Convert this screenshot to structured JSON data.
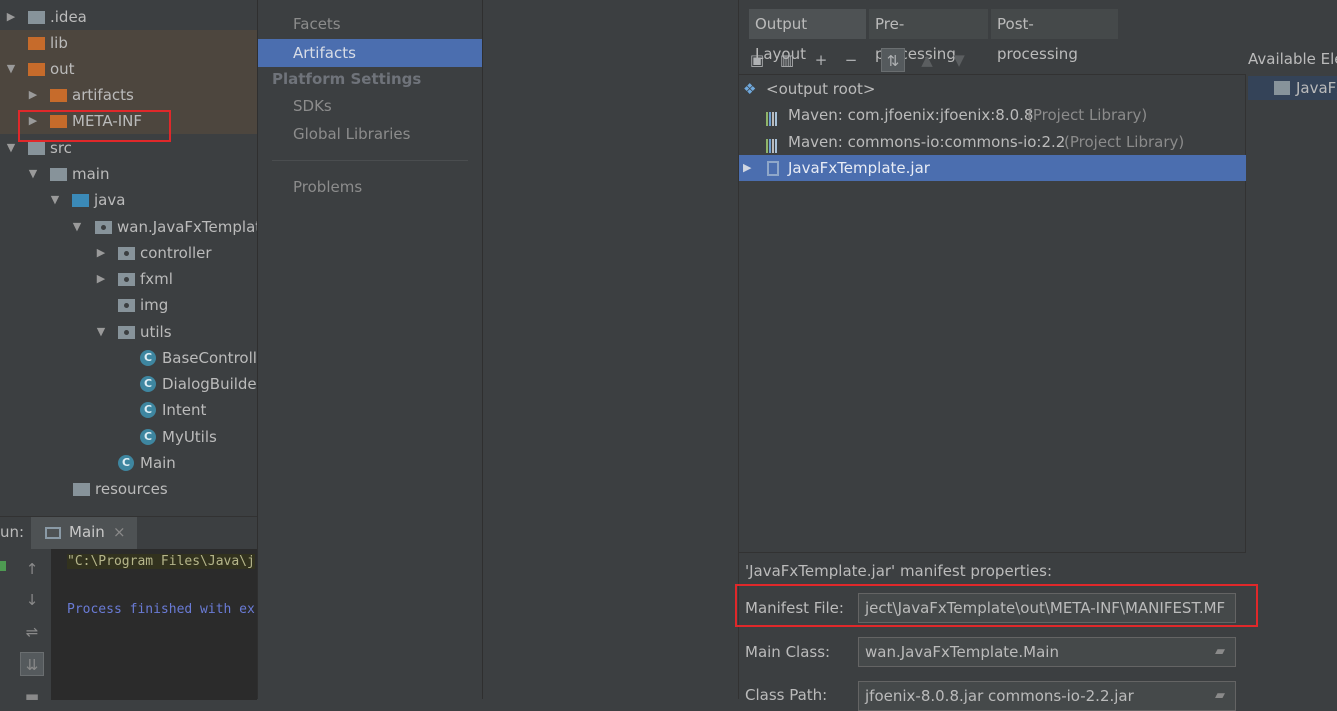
{
  "project_tree": {
    "items": [
      {
        "label": ".idea",
        "icon": "folder-icon",
        "expanded": false
      },
      {
        "label": "lib",
        "icon": "folder-icon"
      },
      {
        "label": "out",
        "icon": "folder-icon",
        "expanded": true
      },
      {
        "label": "artifacts",
        "icon": "folder-icon",
        "expanded": false
      },
      {
        "label": "META-INF",
        "icon": "folder-icon",
        "expanded": false
      },
      {
        "label": "src",
        "icon": "folder-icon",
        "expanded": true
      },
      {
        "label": "main",
        "icon": "folder-icon",
        "expanded": true
      },
      {
        "label": "java",
        "icon": "source-folder-icon",
        "expanded": true
      },
      {
        "label": "wan.JavaFxTemplat",
        "icon": "package-icon",
        "expanded": true
      },
      {
        "label": "controller",
        "icon": "package-icon",
        "expanded": false
      },
      {
        "label": "fxml",
        "icon": "package-icon",
        "expanded": false
      },
      {
        "label": "img",
        "icon": "package-icon"
      },
      {
        "label": "utils",
        "icon": "package-icon",
        "expanded": true
      },
      {
        "label": "BaseControlle",
        "icon": "class-icon"
      },
      {
        "label": "DialogBuilder",
        "icon": "class-icon"
      },
      {
        "label": "Intent",
        "icon": "class-icon"
      },
      {
        "label": "MyUtils",
        "icon": "class-icon"
      },
      {
        "label": "Main",
        "icon": "class-icon"
      },
      {
        "label": "resources",
        "icon": "folder-icon"
      }
    ]
  },
  "run_panel": {
    "label": "un:",
    "tab_label": "Main",
    "close_glyph": "×",
    "console_line1": "\"C:\\Program Files\\Java\\j",
    "console_line2": "Process finished with ex"
  },
  "settings_nav": {
    "items": [
      "Facets",
      "Artifacts"
    ],
    "selected": "Artifacts",
    "section_header": "Platform Settings",
    "platform_items": [
      "SDKs",
      "Global Libraries"
    ],
    "problems": "Problems"
  },
  "artifact_editor": {
    "tabs": [
      "Output Layout",
      "Pre-processing",
      "Post-processing"
    ],
    "selected_tab": "Output Layout",
    "toolbar": {
      "plus": "+",
      "minus": "−"
    },
    "output_root": "<output root>",
    "libraries": [
      {
        "name": "Maven: com.jfoenix:jfoenix:8.0.8",
        "scope": "(Project Library)"
      },
      {
        "name": "Maven: commons-io:commons-io:2.2",
        "scope": "(Project Library)"
      }
    ],
    "jar": "JavaFxTemplate.jar",
    "available_header": "Available Ele",
    "available_item": "JavaFx",
    "manifest_title": "'JavaFxTemplate.jar' manifest properties:",
    "manifest_file_label": "Manifest File:",
    "manifest_file_value": "ject\\JavaFxTemplate\\out\\META-INF\\MANIFEST.MF",
    "main_class_label": "Main Class:",
    "main_class_value": "wan.JavaFxTemplate.Main",
    "class_path_label": "Class Path:",
    "class_path_value": "jfoenix-8.0.8.jar commons-io-2.2.jar"
  },
  "colors": {
    "selection": "#4b6eaf",
    "highlight_border": "#e0282a",
    "background": "#3c3f41"
  }
}
